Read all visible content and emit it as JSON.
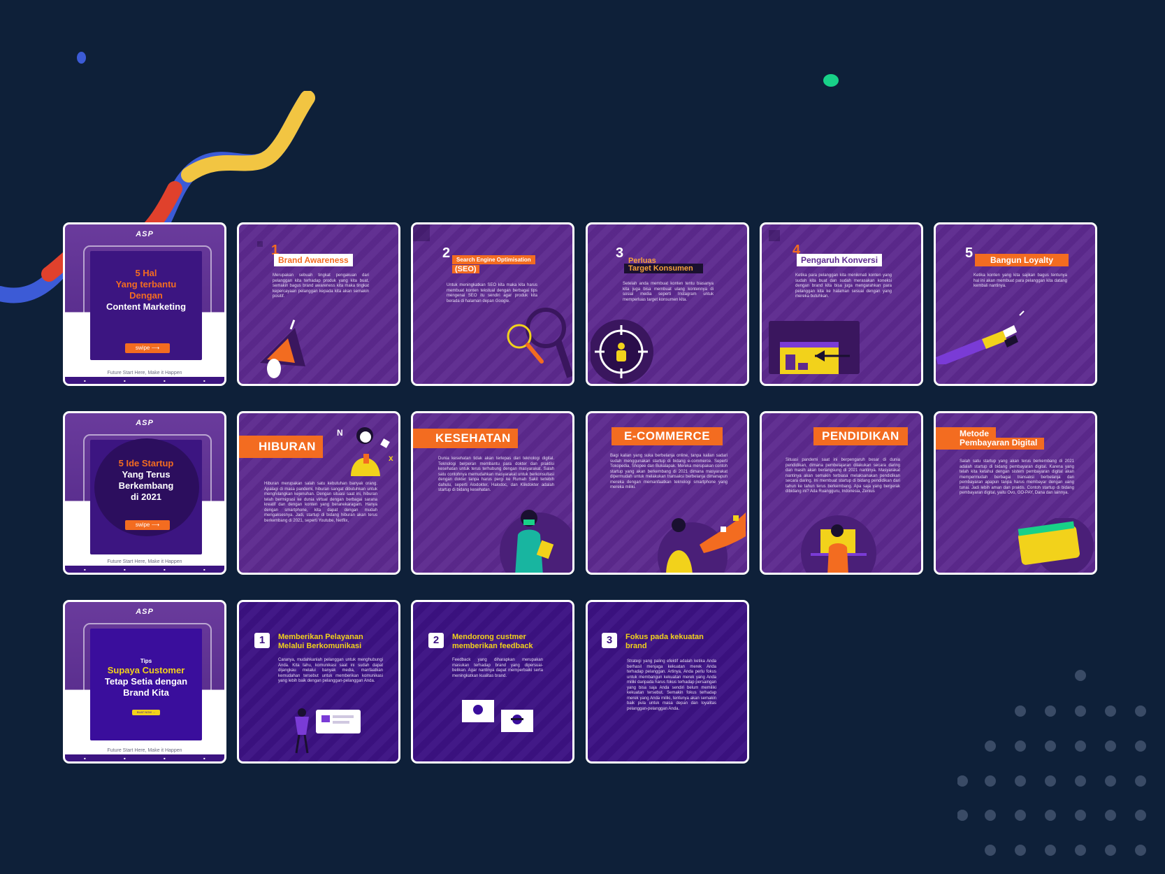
{
  "colors": {
    "background": "#0e2039",
    "card_purple": "#5d2a8f",
    "card_dark": "#3c1283",
    "accent_orange": "#f36c20",
    "accent_yellow": "#f2d21b"
  },
  "cover_common": {
    "logo": "ASP",
    "swipe": "swipe ⟶",
    "footer": "Future Start Here, Make it Happen"
  },
  "row1": {
    "cover": {
      "line1": "5 Hal",
      "line2": "Yang terbantu",
      "line3": "Dengan",
      "line4": "Content Marketing"
    },
    "c1": {
      "num": "1",
      "label": "Brand Awareness",
      "body": "Merupakan sebuah tingkat pengakuan dari pelanggan kita terhadap produk yang kita buat, semakin bagus brand awareness kita maka tingkat kepercayaan pelanggan kepada kita akan semakin positif."
    },
    "c2": {
      "num": "2",
      "label": "Search Engine Optimisation",
      "label2": "(SEO)",
      "body": "Untuk meningkatkan SEO kita maka kita harus membuat konten tekstual dengan berbagai tips mengenai SEO itu sendiri agar produk kita berada di halaman depan Google."
    },
    "c3": {
      "num": "3",
      "label": "Perluas",
      "label2": "Target Konsumen",
      "body": "Setelah anda membuat konten tentu biasanya kita juga bisa membuat ulang kontennya di sosial media seperti Instagram untuk memperluas target konsumen kita."
    },
    "c4": {
      "num": "4",
      "label": "Pengaruh Konversi",
      "body": "Ketika para pelanggan kita menikmati konten yang sudah kita buat dan sudah merasakan koneksi dengan brand kita bisa juga mengarahkan para pelanggan kita ke halaman sesuai dengan yang mereka butuhkan."
    },
    "c5": {
      "num": "5",
      "label": "Bangun Loyalty",
      "body": "Ketika konten yang kita sajikan bagus tentunya hal ini akan membuat para pelanggan kita datang kembali nantinya."
    }
  },
  "row2": {
    "cover": {
      "line1": "5 Ide Startup",
      "line2": "Yang Terus",
      "line3": "Berkembang",
      "line4": "di 2021"
    },
    "c1": {
      "label": "HIBURAN",
      "body": "Hiburan merupakan salah satu kebutuhan banyak orang. Apalagi di masa pandemi, hiburan sangat dibutuhkan untuk menghilangkan kejenuhan. Dengan situasi saat ini, hiburan telah bermigrasi ke dunia virtual dengan berbagai sarana kreatif dan dengan konten yang beranekaragam. Hanya dengan smartphone, kita dapat dengan mudah mengaksesnya. Jadi, startup di bidang hiburan akan terus berkembang di 2021, seperti Youtube, Netflix,"
    },
    "c2": {
      "label": "KESEHATAN",
      "body": "Dunia kesehatan tidak akan terlepas dari teknologi digital. Teknologi berperan membantu para dokter dan praktisi kesehatan untuk terus terhubung dengan masyarakat. Salah satu contohnya memudahkan masyarakat untuk berkonsultasi dengan dokter tanpa harus pergi ke Rumah Sakit terlebih dahulu, seperti Alodokter, Halodoc, dan Klikdokter adalah startup di bidang kesehatan."
    },
    "c3": {
      "label": "E-COMMERCE",
      "body": "Bagi kalian yang suka berbelanja online, tanpa kalian sadari sudah menggunakan startup di bidang e-commerce. Seperti Tokopedia, Shopee dan Bukalapak. Mereka merupakan contoh startup yang akan berkembang di 2021 dimana masyarakat dipermudah untuk melakukan transaksi berbelanja dimanapun mereka dengan memanfaatkan teknologi smartphone yang mereka miliki."
    },
    "c4": {
      "label": "PENDIDIKAN",
      "body": "Situasi pandemi saat ini berpengaruh besar di dunia pendidikan, dimana pembelajaran dilakukan secara daring dan masih akan berlangsung di 2021 nantinya. Masyarakat nantinya akan semakin terbiasa melaksanakan pendidikan secara daring. Ini membuat startup di bidang pendidikan dari tahun ke tahun terus berkembang. Apa saja yang bergerak dibidang ini? Ada Ruangguru, Indonesia, Zenius"
    },
    "c5": {
      "label": "Metode",
      "label2": "Pembayaran Digital",
      "body": "Salah satu startup yang akan terus berkembang di 2021 adalah startup di bidang pembayaran digital. Karena yang telah kita ketahui dengan sistem pembayaran digital akan mempermudah berbagai transaksi berbelanja dan pembayaran apapun tanpa harus membayar dengan uang tunai. Jadi lebih aman dan praktis. Contoh startup di bidang pembayaran digital, yaitu Ovo, GO-PAY, Dana dan lainnya."
    }
  },
  "row3": {
    "cover": {
      "tips": "Tips",
      "line1": "Supaya Customer",
      "line2": "Tetap Setia dengan",
      "line3": "Brand Kita",
      "button": "BUAT NOW →"
    },
    "c1": {
      "num": "1",
      "title1": "Memberikan Pelayanan",
      "title2": "Melalui Berkomunikasi",
      "body": "Caranya, mudahkanlah pelanggan untuk menghubungi Anda. Kita tahu, komunikasi saat ini sudah dapat dijangkau melalui banyak media, manfaatkan kemudahan tersebut untuk memberikan komunikasi yang lebih baik dengan pelanggan-pelanggan Anda."
    },
    "c2": {
      "num": "2",
      "title1": "Mendorong custmer",
      "title2": "memberikan feedback",
      "body": "Feedback yang diharapkan merupakan masukan terhadap brand yang dipersuai-belikan. Agar nantinya dapat memperbaiki serta meningkatkan kualitas brand."
    },
    "c3": {
      "num": "3",
      "title1": "Fokus pada kekuatan",
      "title2": "brand",
      "body": "Strategi yang paling efektif adalah ketika Anda berhasil menjaga kekuatan merek Anda terhadap pelanggan. Artinya, Anda perlu fokus untuk membangun kekuatan merek yang Anda miliki daripada harus fokus terhadap persaingan yang bisa saja Anda sendiri belum memiliki kekuatan tersebut. Semakin fokus terhadap merek yang Anda miliki, tentunya akan semakin baik pula untuk masa depan dan loyalitas pelanggan-pelanggan Anda."
    }
  }
}
